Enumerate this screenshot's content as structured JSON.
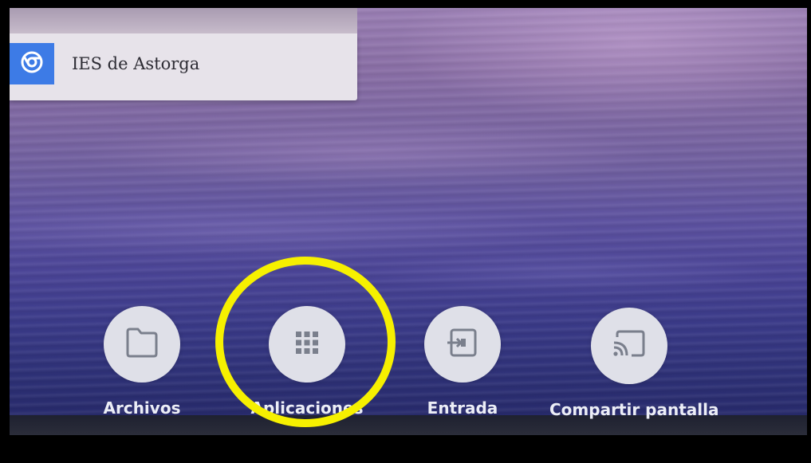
{
  "browser_tile": {
    "title": "IES de Astorga",
    "icon": "chrome-icon"
  },
  "dock": {
    "items": [
      {
        "label": "Archivos",
        "icon": "folder-icon"
      },
      {
        "label": "Aplicaciones",
        "icon": "apps-grid-icon"
      },
      {
        "label": "Entrada",
        "icon": "input-icon"
      },
      {
        "label": "Compartir pantalla",
        "icon": "cast-icon"
      }
    ]
  },
  "colors": {
    "highlight": "#f6f000",
    "chrome_badge": "#3d7be6",
    "dock_circle": "#dfe0e8"
  }
}
